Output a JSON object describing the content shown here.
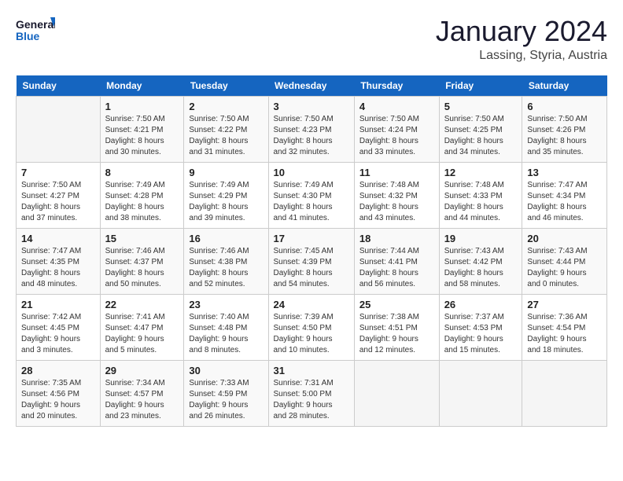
{
  "header": {
    "logo_line1": "General",
    "logo_line2": "Blue",
    "month": "January 2024",
    "location": "Lassing, Styria, Austria"
  },
  "weekdays": [
    "Sunday",
    "Monday",
    "Tuesday",
    "Wednesday",
    "Thursday",
    "Friday",
    "Saturday"
  ],
  "weeks": [
    [
      {
        "day": "",
        "info": ""
      },
      {
        "day": "1",
        "info": "Sunrise: 7:50 AM\nSunset: 4:21 PM\nDaylight: 8 hours\nand 30 minutes."
      },
      {
        "day": "2",
        "info": "Sunrise: 7:50 AM\nSunset: 4:22 PM\nDaylight: 8 hours\nand 31 minutes."
      },
      {
        "day": "3",
        "info": "Sunrise: 7:50 AM\nSunset: 4:23 PM\nDaylight: 8 hours\nand 32 minutes."
      },
      {
        "day": "4",
        "info": "Sunrise: 7:50 AM\nSunset: 4:24 PM\nDaylight: 8 hours\nand 33 minutes."
      },
      {
        "day": "5",
        "info": "Sunrise: 7:50 AM\nSunset: 4:25 PM\nDaylight: 8 hours\nand 34 minutes."
      },
      {
        "day": "6",
        "info": "Sunrise: 7:50 AM\nSunset: 4:26 PM\nDaylight: 8 hours\nand 35 minutes."
      }
    ],
    [
      {
        "day": "7",
        "info": "Sunrise: 7:50 AM\nSunset: 4:27 PM\nDaylight: 8 hours\nand 37 minutes."
      },
      {
        "day": "8",
        "info": "Sunrise: 7:49 AM\nSunset: 4:28 PM\nDaylight: 8 hours\nand 38 minutes."
      },
      {
        "day": "9",
        "info": "Sunrise: 7:49 AM\nSunset: 4:29 PM\nDaylight: 8 hours\nand 39 minutes."
      },
      {
        "day": "10",
        "info": "Sunrise: 7:49 AM\nSunset: 4:30 PM\nDaylight: 8 hours\nand 41 minutes."
      },
      {
        "day": "11",
        "info": "Sunrise: 7:48 AM\nSunset: 4:32 PM\nDaylight: 8 hours\nand 43 minutes."
      },
      {
        "day": "12",
        "info": "Sunrise: 7:48 AM\nSunset: 4:33 PM\nDaylight: 8 hours\nand 44 minutes."
      },
      {
        "day": "13",
        "info": "Sunrise: 7:47 AM\nSunset: 4:34 PM\nDaylight: 8 hours\nand 46 minutes."
      }
    ],
    [
      {
        "day": "14",
        "info": "Sunrise: 7:47 AM\nSunset: 4:35 PM\nDaylight: 8 hours\nand 48 minutes."
      },
      {
        "day": "15",
        "info": "Sunrise: 7:46 AM\nSunset: 4:37 PM\nDaylight: 8 hours\nand 50 minutes."
      },
      {
        "day": "16",
        "info": "Sunrise: 7:46 AM\nSunset: 4:38 PM\nDaylight: 8 hours\nand 52 minutes."
      },
      {
        "day": "17",
        "info": "Sunrise: 7:45 AM\nSunset: 4:39 PM\nDaylight: 8 hours\nand 54 minutes."
      },
      {
        "day": "18",
        "info": "Sunrise: 7:44 AM\nSunset: 4:41 PM\nDaylight: 8 hours\nand 56 minutes."
      },
      {
        "day": "19",
        "info": "Sunrise: 7:43 AM\nSunset: 4:42 PM\nDaylight: 8 hours\nand 58 minutes."
      },
      {
        "day": "20",
        "info": "Sunrise: 7:43 AM\nSunset: 4:44 PM\nDaylight: 9 hours\nand 0 minutes."
      }
    ],
    [
      {
        "day": "21",
        "info": "Sunrise: 7:42 AM\nSunset: 4:45 PM\nDaylight: 9 hours\nand 3 minutes."
      },
      {
        "day": "22",
        "info": "Sunrise: 7:41 AM\nSunset: 4:47 PM\nDaylight: 9 hours\nand 5 minutes."
      },
      {
        "day": "23",
        "info": "Sunrise: 7:40 AM\nSunset: 4:48 PM\nDaylight: 9 hours\nand 8 minutes."
      },
      {
        "day": "24",
        "info": "Sunrise: 7:39 AM\nSunset: 4:50 PM\nDaylight: 9 hours\nand 10 minutes."
      },
      {
        "day": "25",
        "info": "Sunrise: 7:38 AM\nSunset: 4:51 PM\nDaylight: 9 hours\nand 12 minutes."
      },
      {
        "day": "26",
        "info": "Sunrise: 7:37 AM\nSunset: 4:53 PM\nDaylight: 9 hours\nand 15 minutes."
      },
      {
        "day": "27",
        "info": "Sunrise: 7:36 AM\nSunset: 4:54 PM\nDaylight: 9 hours\nand 18 minutes."
      }
    ],
    [
      {
        "day": "28",
        "info": "Sunrise: 7:35 AM\nSunset: 4:56 PM\nDaylight: 9 hours\nand 20 minutes."
      },
      {
        "day": "29",
        "info": "Sunrise: 7:34 AM\nSunset: 4:57 PM\nDaylight: 9 hours\nand 23 minutes."
      },
      {
        "day": "30",
        "info": "Sunrise: 7:33 AM\nSunset: 4:59 PM\nDaylight: 9 hours\nand 26 minutes."
      },
      {
        "day": "31",
        "info": "Sunrise: 7:31 AM\nSunset: 5:00 PM\nDaylight: 9 hours\nand 28 minutes."
      },
      {
        "day": "",
        "info": ""
      },
      {
        "day": "",
        "info": ""
      },
      {
        "day": "",
        "info": ""
      }
    ]
  ]
}
